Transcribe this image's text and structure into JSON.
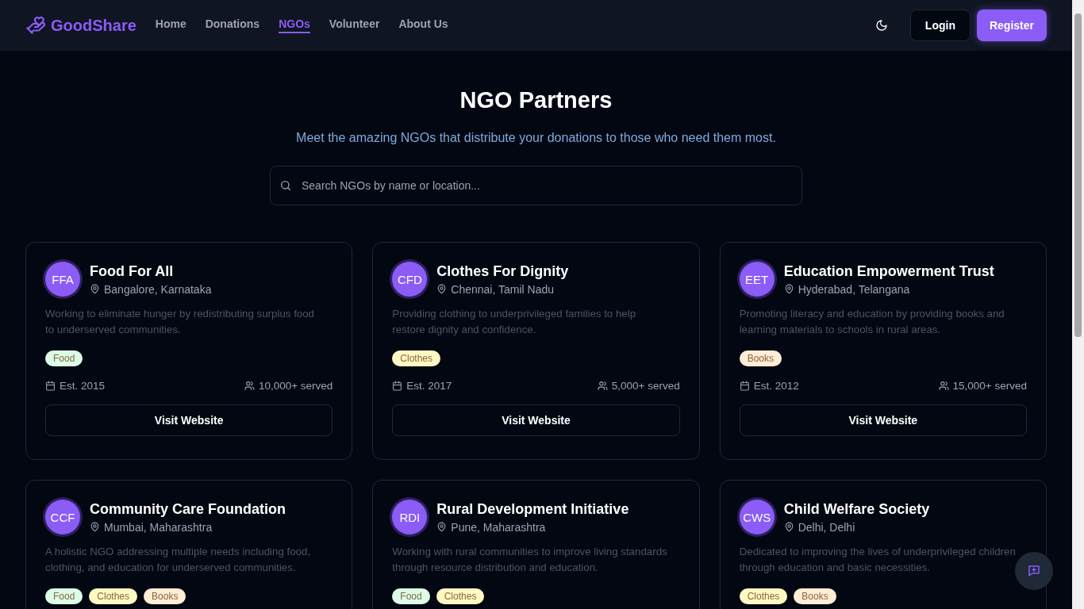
{
  "brand": "GoodShare",
  "nav": [
    {
      "label": "Home",
      "selected": false
    },
    {
      "label": "Donations",
      "selected": false
    },
    {
      "label": "NGOs",
      "selected": true
    },
    {
      "label": "Volunteer",
      "selected": false
    },
    {
      "label": "About Us",
      "selected": false
    }
  ],
  "auth": {
    "login": "Login",
    "register": "Register"
  },
  "page": {
    "title": "NGO Partners",
    "subtitle": "Meet the amazing NGOs that distribute your donations to those who need them most.",
    "search": {
      "placeholder": "Search NGOs by name or location..."
    }
  },
  "ngos": [
    {
      "initials": "FFA",
      "name": "Food For All",
      "location": "Bangalore, Karnataka",
      "description": "Working to eliminate hunger by redistributing surplus food to underserved communities.",
      "tags": [
        {
          "label": "Food",
          "color": "#dcfce7"
        }
      ],
      "established": "Est. 2015",
      "served": "10,000+ served",
      "button": "Visit Website"
    },
    {
      "initials": "CFD",
      "name": "Clothes For Dignity",
      "location": "Chennai, Tamil Nadu",
      "description": "Providing clothing to underprivileged families to help restore dignity and confidence.",
      "tags": [
        {
          "label": "Clothes",
          "color": "#fef9c3"
        }
      ],
      "established": "Est. 2017",
      "served": "5,000+ served",
      "button": "Visit Website"
    },
    {
      "initials": "EET",
      "name": "Education Empowerment Trust",
      "location": "Hyderabad, Telangana",
      "description": "Promoting literacy and education by providing books and learning materials to schools in rural areas.",
      "tags": [
        {
          "label": "Books",
          "color": "#ffedd5"
        }
      ],
      "established": "Est. 2012",
      "served": "15,000+ served",
      "button": "Visit Website"
    },
    {
      "initials": "CCF",
      "name": "Community Care Foundation",
      "location": "Mumbai, Maharashtra",
      "description": "A holistic NGO addressing multiple needs including food, clothing, and education for underserved communities.",
      "tags": [
        {
          "label": "Food",
          "color": "#dcfce7"
        },
        {
          "label": "Clothes",
          "color": "#fef9c3"
        },
        {
          "label": "Books",
          "color": "#ffedd5"
        }
      ]
    },
    {
      "initials": "RDI",
      "name": "Rural Development Initiative",
      "location": "Pune, Maharashtra",
      "description": "Working with rural communities to improve living standards through resource distribution and education.",
      "tags": [
        {
          "label": "Food",
          "color": "#dcfce7"
        },
        {
          "label": "Clothes",
          "color": "#fef9c3"
        }
      ]
    },
    {
      "initials": "CWS",
      "name": "Child Welfare Society",
      "location": "Delhi, Delhi",
      "description": "Dedicated to improving the lives of underprivileged children through education and basic necessities.",
      "tags": [
        {
          "label": "Clothes",
          "color": "#fef9c3"
        },
        {
          "label": "Books",
          "color": "#ffedd5"
        }
      ]
    }
  ]
}
